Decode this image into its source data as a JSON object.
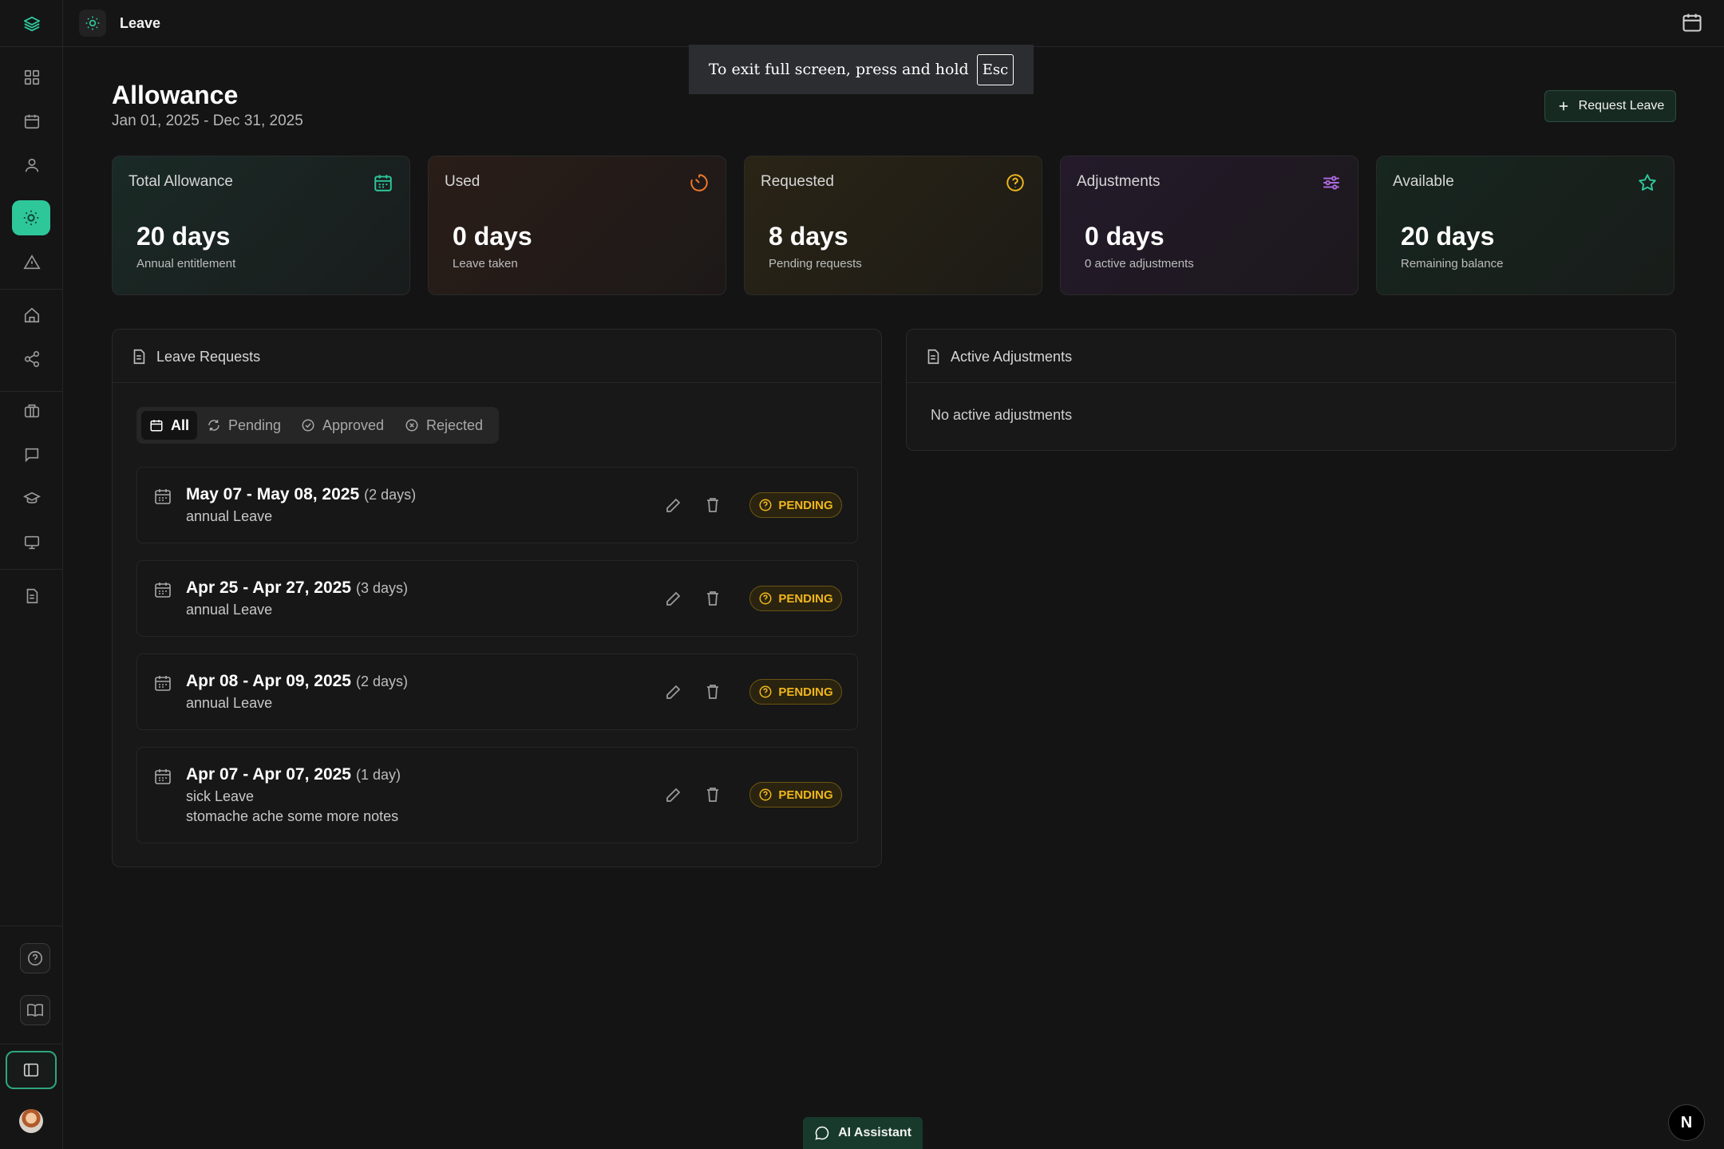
{
  "topbar": {
    "page_label": "Leave"
  },
  "toast": {
    "text": "To exit full screen, press and hold",
    "key": "Esc"
  },
  "header": {
    "title": "Allowance",
    "range": "Jan 01, 2025 - Dec 31, 2025",
    "request_button": "Request Leave"
  },
  "stats": [
    {
      "label": "Total Allowance",
      "value": "20 days",
      "sub": "Annual entitlement",
      "icon": "calendar-icon",
      "accent": "#2ec79a"
    },
    {
      "label": "Used",
      "value": "0 days",
      "sub": "Leave taken",
      "icon": "timer-icon",
      "accent": "#f07a2a"
    },
    {
      "label": "Requested",
      "value": "8 days",
      "sub": "Pending requests",
      "icon": "help-circle-icon",
      "accent": "#f0b71c"
    },
    {
      "label": "Adjustments",
      "value": "0 days",
      "sub": "0 active adjustments",
      "icon": "sliders-icon",
      "accent": "#b06ae0"
    },
    {
      "label": "Available",
      "value": "20 days",
      "sub": "Remaining balance",
      "icon": "star-icon",
      "accent": "#2ec79a"
    }
  ],
  "requests_panel": {
    "title": "Leave Requests",
    "tabs": [
      "All",
      "Pending",
      "Approved",
      "Rejected"
    ],
    "items": [
      {
        "dates": "May 07 - May 08, 2025",
        "days": "(2 days)",
        "type": "annual Leave",
        "note": "",
        "status": "PENDING"
      },
      {
        "dates": "Apr 25 - Apr 27, 2025",
        "days": "(3 days)",
        "type": "annual Leave",
        "note": "",
        "status": "PENDING"
      },
      {
        "dates": "Apr 08 - Apr 09, 2025",
        "days": "(2 days)",
        "type": "annual Leave",
        "note": "",
        "status": "PENDING"
      },
      {
        "dates": "Apr 07 - Apr 07, 2025",
        "days": "(1 day)",
        "type": "sick Leave",
        "note": "stomache ache some more notes",
        "status": "PENDING"
      }
    ]
  },
  "adjustments_panel": {
    "title": "Active Adjustments",
    "empty_text": "No active adjustments"
  },
  "ai_assistant": {
    "label": "AI Assistant"
  },
  "corner_badge": {
    "label": "N"
  },
  "colors": {
    "accent": "#2ec79a",
    "pending": "#f0b71c",
    "background": "#141414"
  }
}
